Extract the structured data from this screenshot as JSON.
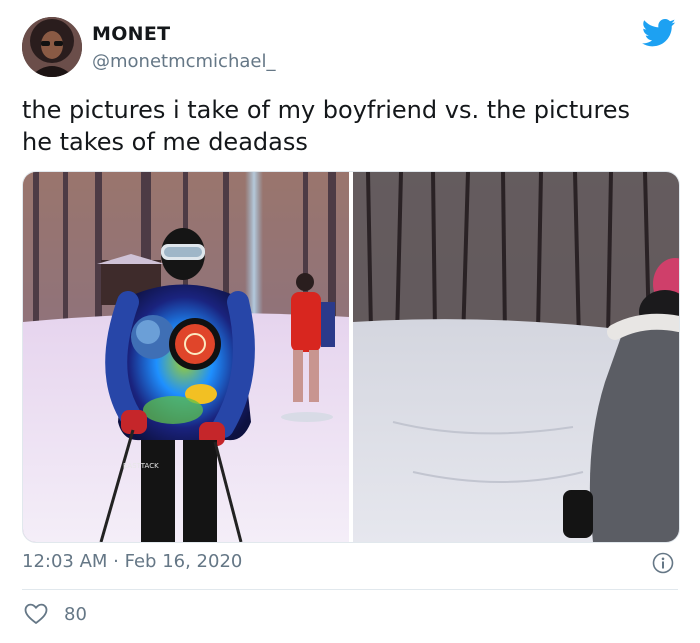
{
  "author": {
    "name": "MONET",
    "handle": "@monetmcmichael_"
  },
  "tweet": {
    "text_line1": "the pictures i take of my boyfriend vs. the pictures",
    "text_line2": "he takes of me deadass",
    "timestamp": "12:03 AM · Feb 16, 2020",
    "likes": "80"
  },
  "icons": {
    "brand": "twitter-bird-icon",
    "info": "info-icon",
    "like": "heart-icon"
  },
  "colors": {
    "twitter_blue": "#1da1f2",
    "secondary_text": "#657786",
    "primary_text": "#14171a"
  }
}
